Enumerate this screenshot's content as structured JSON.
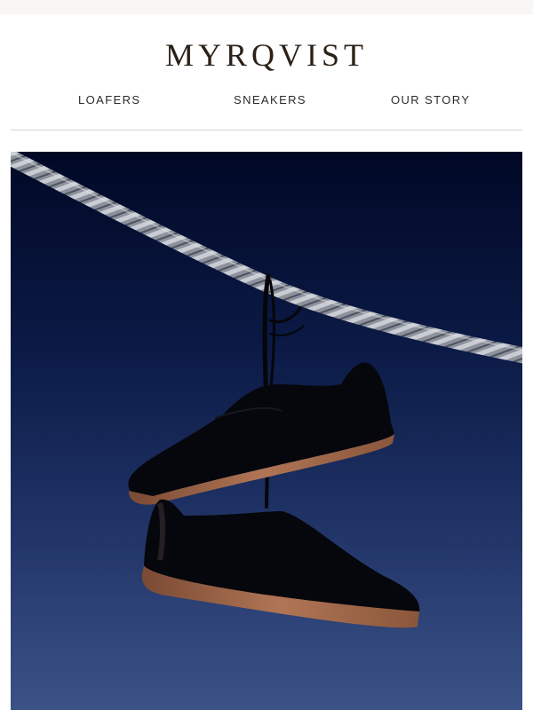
{
  "header": {
    "brand": "MYRQVIST"
  },
  "nav": {
    "items": [
      {
        "label": "LOAFERS"
      },
      {
        "label": "SNEAKERS"
      },
      {
        "label": "OUR STORY"
      }
    ]
  },
  "hero": {
    "icon": "hanging-sneakers-image",
    "colors": {
      "sky_top": "#010826",
      "sky_bottom": "#3c5286",
      "shoe": "#07080d",
      "sole": "#a06a4a"
    }
  }
}
